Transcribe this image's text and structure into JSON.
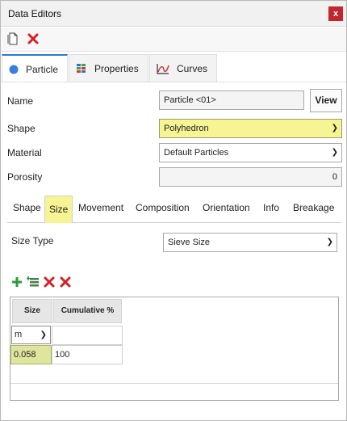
{
  "window": {
    "title": "Data Editors",
    "close_label": "x"
  },
  "toolbar": {
    "new_icon": "new-document-icon",
    "delete_icon": "delete-icon"
  },
  "main_tabs": [
    {
      "label": "Particle",
      "icon": "particle-circle-icon",
      "active": true
    },
    {
      "label": "Properties",
      "icon": "properties-icon",
      "active": false
    },
    {
      "label": "Curves",
      "icon": "curves-chart-icon",
      "active": false
    }
  ],
  "fields": {
    "name": {
      "label": "Name",
      "value": "Particle <01>",
      "button": "View"
    },
    "shape": {
      "label": "Shape",
      "value": "Polyhedron"
    },
    "material": {
      "label": "Material",
      "value": "Default Particles"
    },
    "porosity": {
      "label": "Porosity",
      "value": "0"
    }
  },
  "sub_tabs": [
    {
      "label": "Shape",
      "active": false
    },
    {
      "label": "Size",
      "active": true
    },
    {
      "label": "Movement",
      "active": false
    },
    {
      "label": "Composition",
      "active": false
    },
    {
      "label": "Orientation",
      "active": false
    },
    {
      "label": "Info",
      "active": false
    },
    {
      "label": "Breakage",
      "active": false
    }
  ],
  "size_type": {
    "label": "Size Type",
    "value": "Sieve Size"
  },
  "size_table": {
    "headers": {
      "size": "Size",
      "cumulative": "Cumulative %"
    },
    "unit": "m",
    "rows": [
      {
        "size": "0.058",
        "cumulative": "100"
      }
    ]
  },
  "colors": {
    "accent": "#2a7ad8",
    "highlight": "#f7f493",
    "close": "#c1272d",
    "selected_cell": "#dfe59c"
  }
}
